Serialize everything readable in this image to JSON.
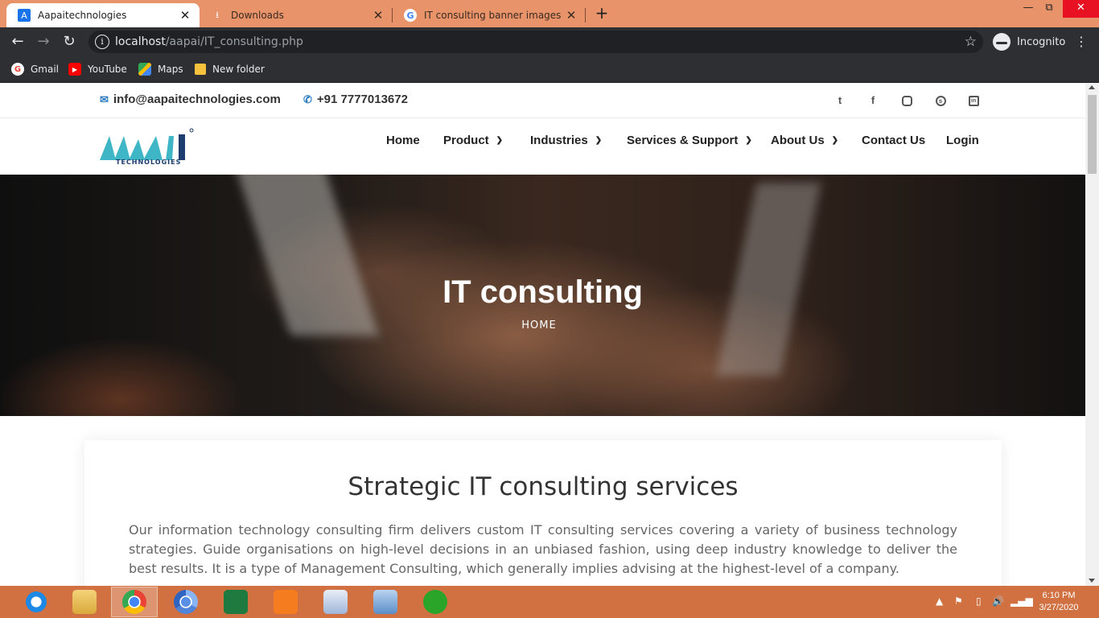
{
  "browser": {
    "tabs": [
      {
        "title": "Aapaitechnologies",
        "icon": "aapai-favicon",
        "close": "✕"
      },
      {
        "title": "Downloads",
        "icon": "download-icon",
        "close": "✕"
      },
      {
        "title": "IT consulting banner images hd -",
        "icon": "google-icon",
        "close": "✕"
      }
    ],
    "new_tab": "+",
    "url_host": "localhost",
    "url_path": "/aapai/IT_consulting.php",
    "incognito_label": "Incognito",
    "bookmarks": [
      {
        "label": "Gmail",
        "icon": "google-icon"
      },
      {
        "label": "YouTube",
        "icon": "youtube-icon"
      },
      {
        "label": "Maps",
        "icon": "maps-icon"
      },
      {
        "label": "New folder",
        "icon": "folder-icon"
      }
    ]
  },
  "site": {
    "email": "info@aapaitechnologies.com",
    "phone": "+91 7777013672",
    "social": [
      "twitter-icon",
      "facebook-icon",
      "instagram-icon",
      "skype-icon",
      "linkedin-icon"
    ],
    "logo_text": "TECHNOLOGIES",
    "logo_letters": "AAPAI",
    "nav": [
      {
        "label": "Home",
        "dropdown": false
      },
      {
        "label": "Product",
        "dropdown": true
      },
      {
        "label": "Industries",
        "dropdown": true
      },
      {
        "label": "Services & Support",
        "dropdown": true
      },
      {
        "label": "About Us",
        "dropdown": true
      },
      {
        "label": "Contact Us",
        "dropdown": false
      },
      {
        "label": "Login",
        "dropdown": false
      }
    ],
    "hero": {
      "title": "IT consulting",
      "breadcrumb": "HOME"
    },
    "section": {
      "heading": "Strategic IT consulting services",
      "body": "Our information technology consulting firm delivers custom IT consulting services covering a variety of business technology strategies. Guide organisations on high-level decisions in an unbiased fashion, using deep industry knowledge to deliver the best results. It is a type of Management Consulting, which generally implies advising at the highest-level of a company."
    }
  },
  "taskbar": {
    "apps": [
      "internet-explorer-icon",
      "file-explorer-icon",
      "chrome-icon",
      "chromium-icon",
      "excel-icon",
      "xampp-icon",
      "text-editor-icon",
      "control-panel-icon",
      "green-app-icon"
    ],
    "active_index": 2,
    "time": "6:10 PM",
    "date": "3/27/2020"
  },
  "colors": {
    "accent": "#2b7bc4",
    "logo_teal": "#3fb6c6",
    "tabbar": "#e8936a",
    "taskbar": "#d17142"
  }
}
